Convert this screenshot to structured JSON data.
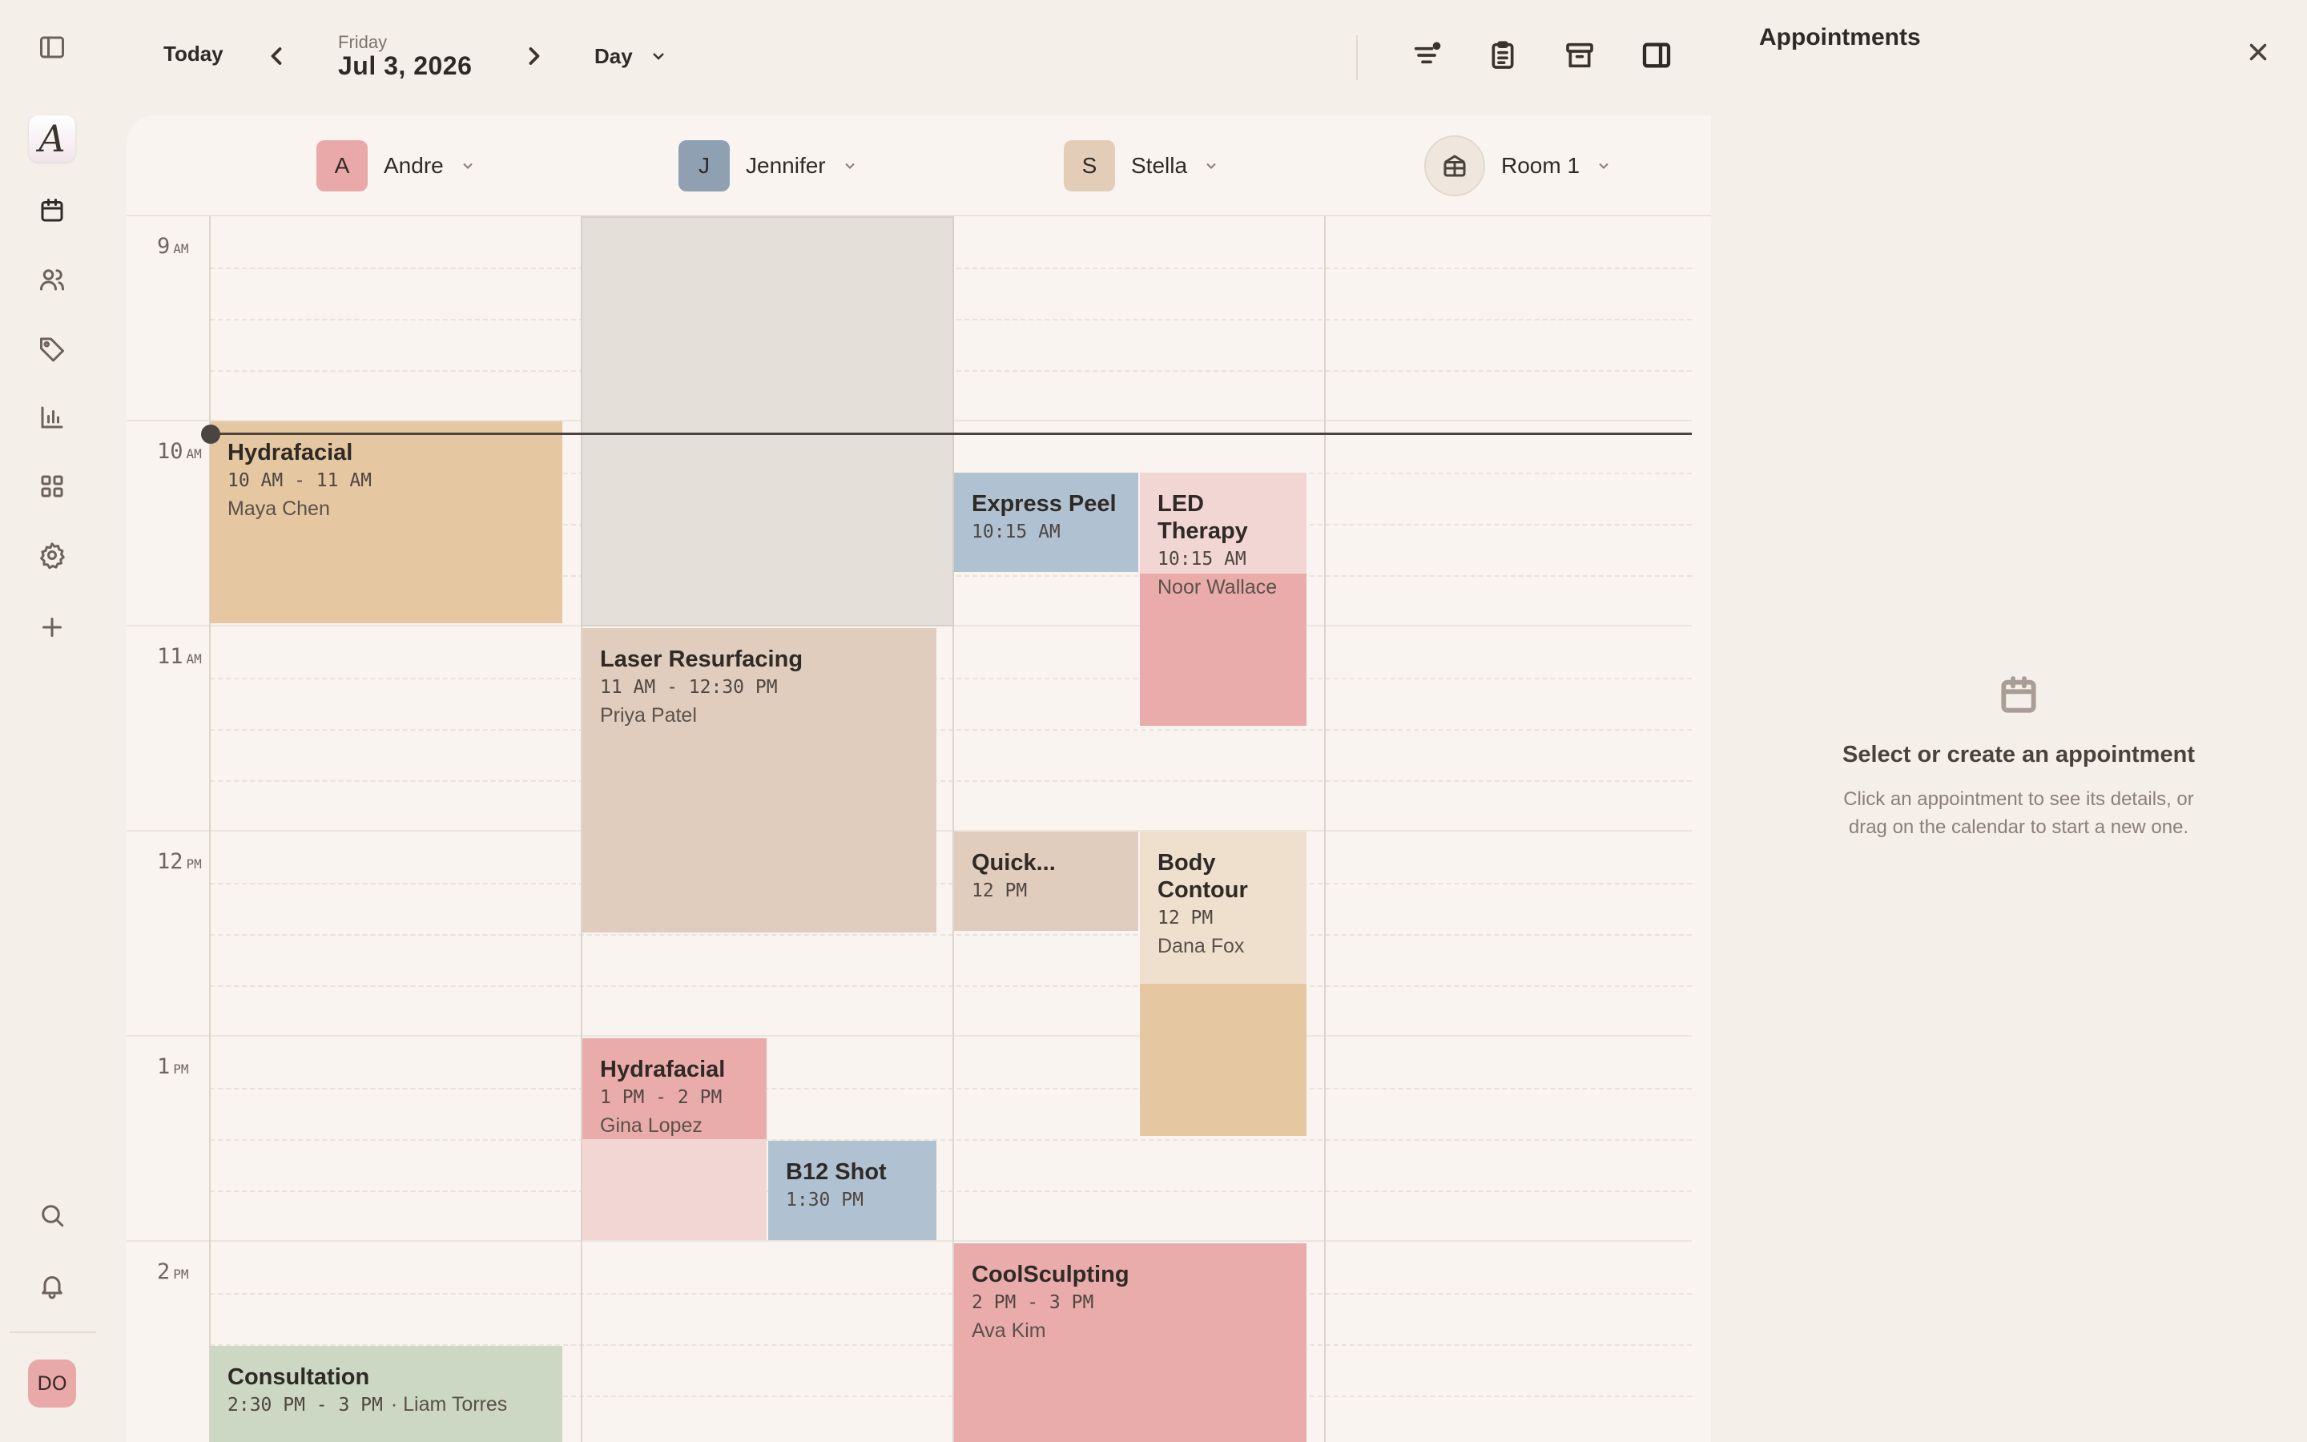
{
  "app": {
    "logo_letter": "A",
    "user_initials": "DO"
  },
  "sidebar": {
    "items": [
      {
        "name": "toggle-sidebar",
        "icon": "sidebar-toggle-icon"
      },
      {
        "name": "calendar",
        "icon": "calendar-icon"
      },
      {
        "name": "clients",
        "icon": "users-icon"
      },
      {
        "name": "services",
        "icon": "tag-icon"
      },
      {
        "name": "reports",
        "icon": "bar-chart-icon"
      },
      {
        "name": "apps",
        "icon": "grid-icon"
      },
      {
        "name": "settings",
        "icon": "gear-icon"
      },
      {
        "name": "add",
        "icon": "plus-icon"
      },
      {
        "name": "search",
        "icon": "search-icon"
      },
      {
        "name": "notifications",
        "icon": "bell-icon"
      }
    ]
  },
  "toolbar": {
    "today_label": "Today",
    "weekday": "Friday",
    "date": "Jul 3, 2026",
    "view_label": "Day",
    "icons": [
      "filter-icon",
      "clipboard-icon",
      "archive-icon",
      "panel-toggle-icon"
    ]
  },
  "columns": [
    {
      "name": "Andre",
      "initial": "A",
      "color": "#e8a9a8"
    },
    {
      "name": "Jennifer",
      "initial": "J",
      "color": "#8fa0b3"
    },
    {
      "name": "Stella",
      "initial": "S",
      "color": "#e4cdb8"
    },
    {
      "name": "Room 1",
      "icon": "room-icon"
    }
  ],
  "time_labels": [
    {
      "hour": "9",
      "ampm": "AM"
    },
    {
      "hour": "10",
      "ampm": "AM"
    },
    {
      "hour": "11",
      "ampm": "AM"
    },
    {
      "hour": "12",
      "ampm": "PM"
    },
    {
      "hour": "1",
      "ampm": "PM"
    },
    {
      "hour": "2",
      "ampm": "PM"
    }
  ],
  "events": [
    {
      "title": "Hydrafacial",
      "time": "10 AM - 11 AM",
      "client": "Maya Chen"
    },
    {
      "title": "Laser Resurfacing",
      "time": "11 AM - 12:30 PM",
      "client": "Priya Patel"
    },
    {
      "title": "Hydrafacial",
      "time": "1 PM - 2 PM",
      "client": "Gina Lopez"
    },
    {
      "title": "B12 Shot",
      "time": "1:30 PM",
      "client": ""
    },
    {
      "title": "Express Peel",
      "time": "10:15 AM",
      "client": ""
    },
    {
      "title": "LED Therapy",
      "time": "10:15 AM",
      "client": "Noor Wallace"
    },
    {
      "title": "Quick...",
      "time": "12 PM",
      "client": ""
    },
    {
      "title": "Body Contour",
      "time": "12 PM",
      "client": "Dana Fox"
    },
    {
      "title": "CoolSculpting",
      "time": "2 PM - 3 PM",
      "client": "Ava Kim"
    },
    {
      "title": "Consultation",
      "time": "2:30 PM - 3 PM",
      "client": "· Liam Torres"
    }
  ],
  "colors": {
    "peach": "#e5c7a2",
    "tan": "#e1cdbd",
    "pink": "#eaacab",
    "light_pink": "#f2d6d4",
    "blue": "#b0c1d2",
    "sand": "#efe0cd",
    "green": "#ccd8c3",
    "blocked": "#e4dfd9"
  },
  "panel": {
    "title": "Appointments",
    "empty_title": "Select or create an appointment",
    "empty_description": "Click an appointment to see its details, or drag on the calendar to start a new one."
  }
}
